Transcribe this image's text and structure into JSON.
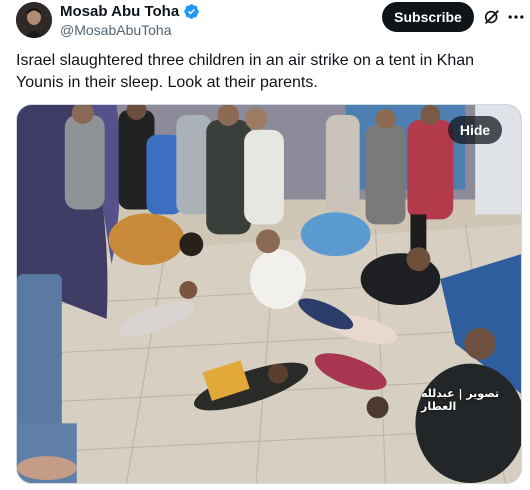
{
  "author": {
    "display_name": "Mosab Abu Toha",
    "handle": "@MosabAbuToha",
    "verified": true,
    "avatar_icon": "profile-photo"
  },
  "actions": {
    "subscribe_label": "Subscribe",
    "grok_icon": "grok-icon",
    "more_icon": "more-options-icon"
  },
  "tweet": {
    "text": "Israel slaughtered three children in an air strike on a tent in Khan Younis in their sleep. Look at their parents."
  },
  "media": {
    "hide_label": "Hide",
    "watermark": "تصوير | عبدلله العطار"
  },
  "colors": {
    "text_primary": "#0f1419",
    "text_secondary": "#536471",
    "verified_blue": "#1d9bf0",
    "subscribe_bg": "#0f1419"
  }
}
